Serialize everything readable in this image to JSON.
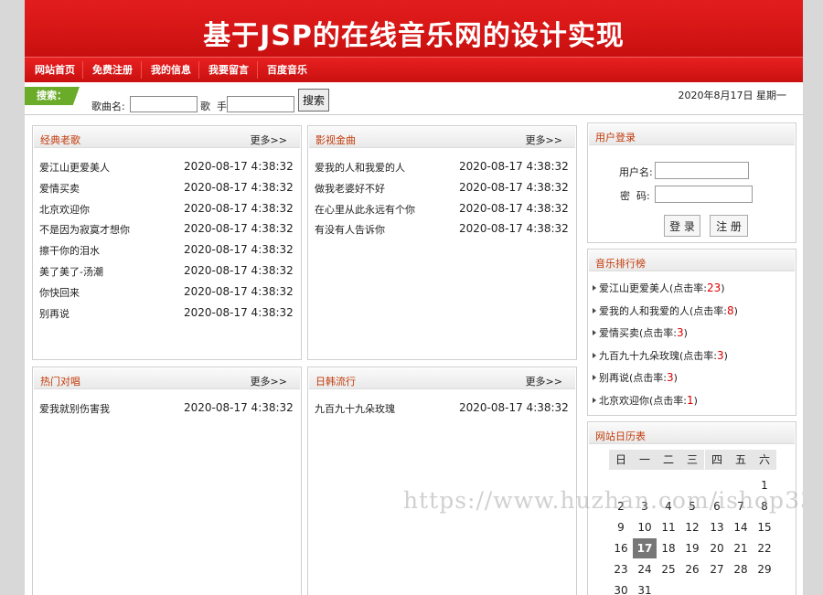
{
  "banner": {
    "title": "基于JSP的在线音乐网的设计实现"
  },
  "nav": [
    "网站首页",
    "免费注册",
    "我的信息",
    "我要留言",
    "百度音乐"
  ],
  "search": {
    "tag": "搜索：",
    "song_label": "歌曲名:",
    "song_value": "",
    "singer_label": "歌  手:",
    "singer_value": "",
    "button": "搜索"
  },
  "date": "2020年8月17日 星期一",
  "more_label": "更多>>",
  "panels": [
    {
      "title": "经典老歌",
      "songs": [
        {
          "name": "爱江山更爱美人",
          "time": "2020-08-17 4:38:32"
        },
        {
          "name": "爱情买卖",
          "time": "2020-08-17 4:38:32"
        },
        {
          "name": "北京欢迎你",
          "time": "2020-08-17 4:38:32"
        },
        {
          "name": "不是因为寂寞才想你",
          "time": "2020-08-17 4:38:32"
        },
        {
          "name": "擦干你的泪水",
          "time": "2020-08-17 4:38:32"
        },
        {
          "name": "美了美了-汤潮",
          "time": "2020-08-17 4:38:32"
        },
        {
          "name": "你快回来",
          "time": "2020-08-17 4:38:32"
        },
        {
          "name": "别再说",
          "time": "2020-08-17 4:38:32"
        }
      ]
    },
    {
      "title": "影视金曲",
      "songs": [
        {
          "name": "爱我的人和我爱的人",
          "time": "2020-08-17 4:38:32"
        },
        {
          "name": "做我老婆好不好",
          "time": "2020-08-17 4:38:32"
        },
        {
          "name": "在心里从此永远有个你",
          "time": "2020-08-17 4:38:32"
        },
        {
          "name": "有没有人告诉你",
          "time": "2020-08-17 4:38:32"
        }
      ]
    },
    {
      "title": "热门对唱",
      "songs": [
        {
          "name": "爱我就别伤害我",
          "time": "2020-08-17 4:38:32"
        }
      ]
    },
    {
      "title": "日韩流行",
      "songs": [
        {
          "name": "九百九十九朵玫瑰",
          "time": "2020-08-17 4:38:32"
        }
      ]
    }
  ],
  "login": {
    "title": "用户登录",
    "username_label": "用户名:",
    "password_label": "密  码:",
    "login_button": "登 录",
    "register_button": "注 册"
  },
  "ranking": {
    "title": "音乐排行榜",
    "items": [
      {
        "text": "爱江山更爱美人(点击率:",
        "count": "23",
        "close": ")"
      },
      {
        "text": "爱我的人和我爱的人(点击率:",
        "count": "8",
        "close": ")"
      },
      {
        "text": "爱情买卖(点击率:",
        "count": "3",
        "close": ")"
      },
      {
        "text": "九百九十九朵玫瑰(点击率:",
        "count": "3",
        "close": ")"
      },
      {
        "text": "别再说(点击率:",
        "count": "3",
        "close": ")"
      },
      {
        "text": "北京欢迎你(点击率:",
        "count": "1",
        "close": ")"
      }
    ]
  },
  "calendar": {
    "title": "网站日历表",
    "weekdays": [
      "日",
      "一",
      "二",
      "三",
      "四",
      "五",
      "六"
    ],
    "days": [
      "1",
      "2",
      "3",
      "4",
      "5",
      "6",
      "7",
      "8",
      "9",
      "10",
      "11",
      "12",
      "13",
      "14",
      "15",
      "16",
      "17",
      "18",
      "19",
      "20",
      "21",
      "22",
      "23",
      "24",
      "25",
      "26",
      "27",
      "28",
      "29",
      "30",
      "31"
    ],
    "today": "17"
  },
  "watermark": "https://www.huzhan.com/ishop33466"
}
